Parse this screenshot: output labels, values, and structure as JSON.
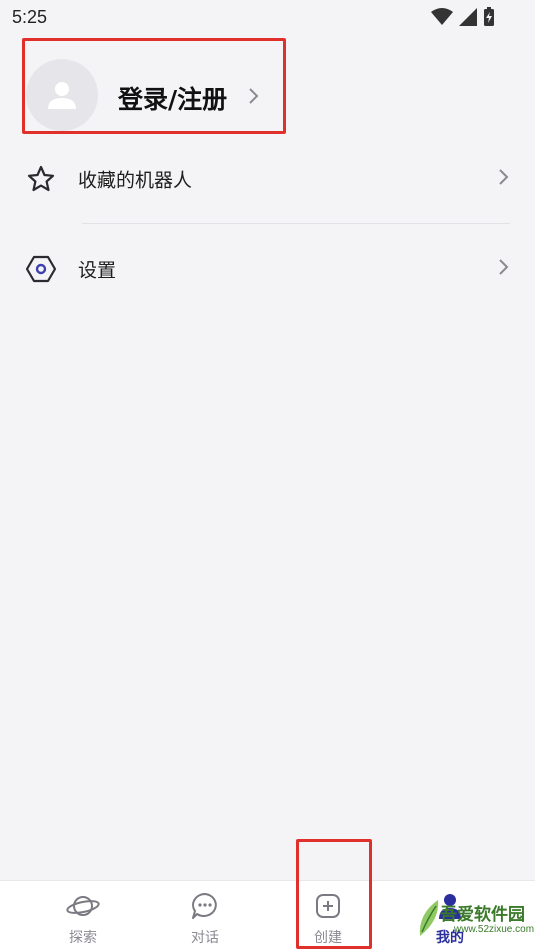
{
  "status_bar": {
    "time": "5:25",
    "icons": [
      "wifi-icon",
      "cellular-signal-icon",
      "battery-charging-icon"
    ]
  },
  "profile": {
    "login_label": "登录/注册",
    "avatar_icon": "user-avatar-icon"
  },
  "menu": {
    "items": [
      {
        "label": "收藏的机器人",
        "icon": "star-icon"
      },
      {
        "label": "设置",
        "icon": "settings-hexagon-icon"
      }
    ]
  },
  "bottom_nav": {
    "tabs": [
      {
        "label": "探索",
        "icon": "planet-icon"
      },
      {
        "label": "对话",
        "icon": "chat-bubble-icon"
      },
      {
        "label": "创建",
        "icon": "add-square-icon"
      },
      {
        "label": "我的",
        "icon": "person-icon",
        "active": true
      }
    ]
  },
  "watermark": {
    "title": "吾爱软件园",
    "url": "www.52zixue.com"
  },
  "colors": {
    "highlight": "#e0302b",
    "accent": "#2b2f9e",
    "background": "#f4f4f6"
  }
}
